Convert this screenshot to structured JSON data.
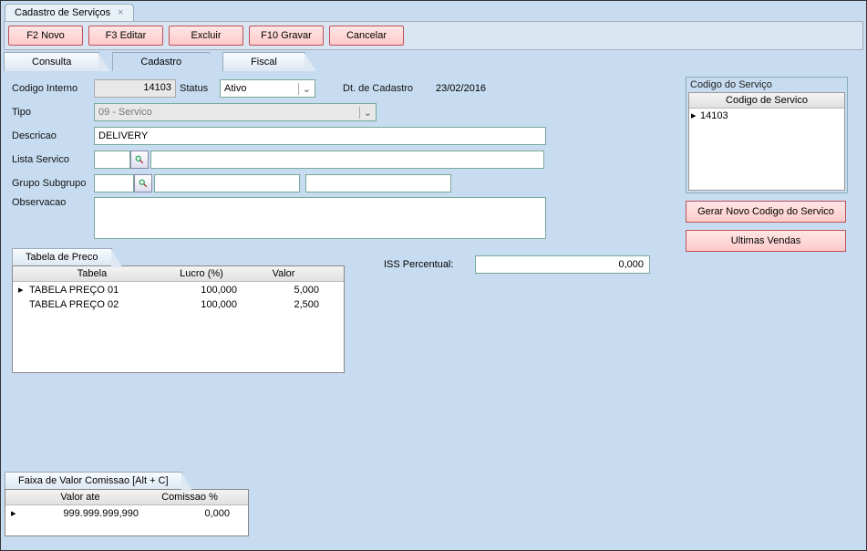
{
  "window": {
    "title": "Cadastro de Serviços"
  },
  "toolbar": {
    "novo": "F2 Novo",
    "editar": "F3 Editar",
    "excluir": "Excluir",
    "gravar": "F10 Gravar",
    "cancelar": "Cancelar"
  },
  "tabs": {
    "consulta": "Consulta",
    "cadastro": "Cadastro",
    "fiscal": "Fiscal"
  },
  "form": {
    "codigo_interno_label": "Codigo Interno",
    "codigo_interno_value": "14103",
    "status_label": "Status",
    "status_value": "Ativo",
    "dt_cadastro_label": "Dt. de Cadastro",
    "dt_cadastro_value": "23/02/2016",
    "tipo_label": "Tipo",
    "tipo_value": "09 - Servico",
    "descricao_label": "Descricao",
    "descricao_value": "DELIVERY",
    "lista_servico_label": "Lista Servico",
    "grupo_subgrupo_label": "Grupo Subgrupo",
    "observacao_label": "Observacao"
  },
  "codigo_servico": {
    "title": "Codigo do Serviço",
    "header": "Codigo de Servico",
    "value": "14103"
  },
  "buttons": {
    "gerar_codigo": "Gerar Novo Codigo do Servico",
    "ultimas_vendas": "Ultimas Vendas"
  },
  "tabela_preco": {
    "title": "Tabela de Preco",
    "headers": {
      "tabela": "Tabela",
      "lucro": "Lucro (%)",
      "valor": "Valor"
    },
    "rows": [
      {
        "tabela": "TABELA PREÇO 01",
        "lucro": "100,000",
        "valor": "5,000"
      },
      {
        "tabela": "TABELA PREÇO 02",
        "lucro": "100,000",
        "valor": "2,500"
      }
    ]
  },
  "iss": {
    "label": "ISS Percentual:",
    "value": "0,000"
  },
  "comissao": {
    "title": "Faixa de Valor Comissao [Alt + C]",
    "headers": {
      "valor_ate": "Valor ate",
      "comissao_pct": "Comissao %"
    },
    "rows": [
      {
        "valor_ate": "999.999.999,990",
        "comissao_pct": "0,000"
      }
    ]
  }
}
